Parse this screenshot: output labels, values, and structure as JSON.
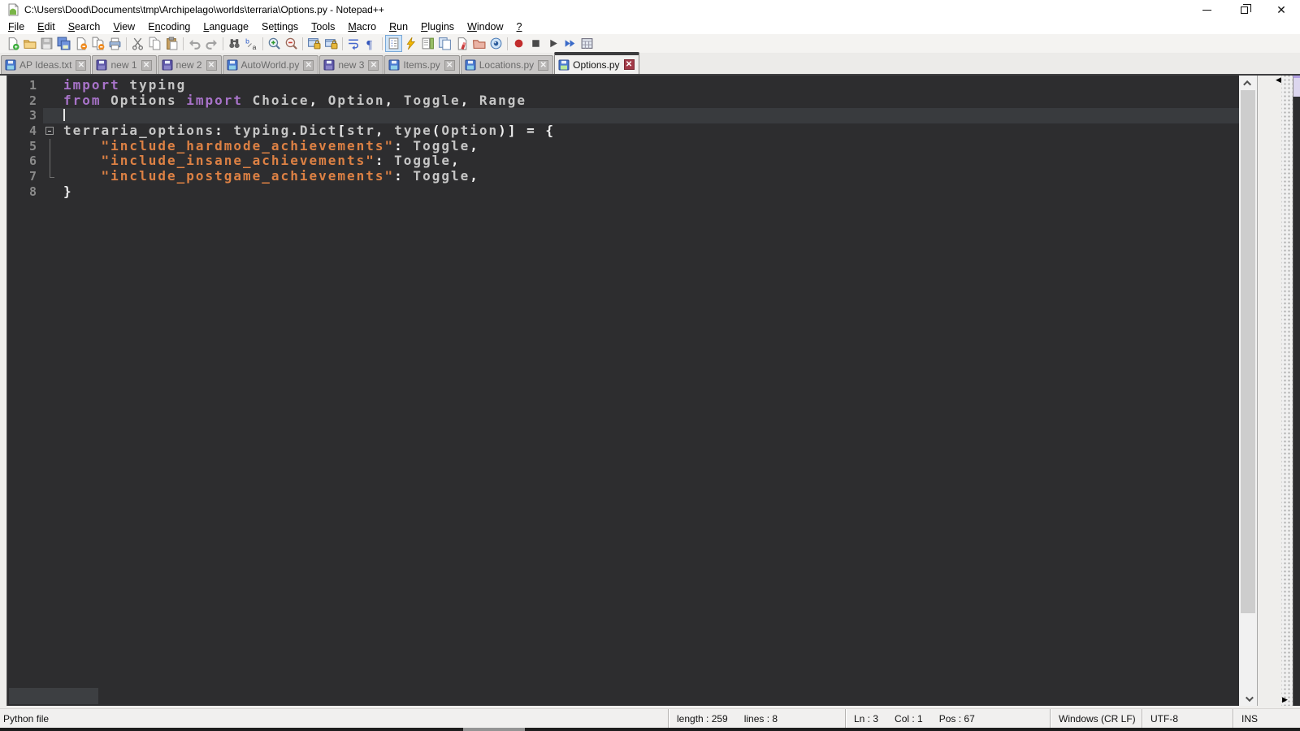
{
  "window": {
    "title": "C:\\Users\\Dood\\Documents\\tmp\\Archipelago\\worlds\\terraria\\Options.py - Notepad++",
    "controls": [
      {
        "name": "minimize-button",
        "icon": "minimize-icon"
      },
      {
        "name": "restore-button",
        "icon": "restore-icon"
      },
      {
        "name": "close-button",
        "icon": "close-icon"
      }
    ]
  },
  "menu": {
    "items": [
      {
        "label": "File",
        "underline": 0
      },
      {
        "label": "Edit",
        "underline": 0
      },
      {
        "label": "Search",
        "underline": 0
      },
      {
        "label": "View",
        "underline": 0
      },
      {
        "label": "Encoding",
        "underline": 1
      },
      {
        "label": "Language",
        "underline": 0
      },
      {
        "label": "Settings",
        "underline": 2
      },
      {
        "label": "Tools",
        "underline": 0
      },
      {
        "label": "Macro",
        "underline": 0
      },
      {
        "label": "Run",
        "underline": 0
      },
      {
        "label": "Plugins",
        "underline": 0
      },
      {
        "label": "Window",
        "underline": 0
      },
      {
        "label": "?",
        "underline": 0
      }
    ]
  },
  "toolbar": {
    "buttons": [
      {
        "name": "new-file-icon",
        "icon": "new"
      },
      {
        "name": "open-file-icon",
        "icon": "open"
      },
      {
        "name": "save-icon",
        "icon": "save"
      },
      {
        "name": "save-all-icon",
        "icon": "saveall"
      },
      {
        "name": "close-file-icon",
        "icon": "closedoc"
      },
      {
        "name": "close-all-icon",
        "icon": "closeall"
      },
      {
        "name": "print-icon",
        "icon": "print"
      },
      {
        "name": "separator"
      },
      {
        "name": "cut-icon",
        "icon": "cut"
      },
      {
        "name": "copy-icon",
        "icon": "copy"
      },
      {
        "name": "paste-icon",
        "icon": "paste"
      },
      {
        "name": "separator"
      },
      {
        "name": "undo-icon",
        "icon": "undo"
      },
      {
        "name": "redo-icon",
        "icon": "redo"
      },
      {
        "name": "separator"
      },
      {
        "name": "find-icon",
        "icon": "find"
      },
      {
        "name": "replace-icon",
        "icon": "replace"
      },
      {
        "name": "separator"
      },
      {
        "name": "zoom-in-icon",
        "icon": "zoomin"
      },
      {
        "name": "zoom-out-icon",
        "icon": "zoomout"
      },
      {
        "name": "separator"
      },
      {
        "name": "sync-vertical-scroll-icon",
        "icon": "syncv"
      },
      {
        "name": "sync-horizontal-scroll-icon",
        "icon": "synch"
      },
      {
        "name": "separator"
      },
      {
        "name": "word-wrap-icon",
        "icon": "wrap"
      },
      {
        "name": "show-all-characters-icon",
        "icon": "pilcrow"
      },
      {
        "name": "separator"
      },
      {
        "name": "indent-guide-icon",
        "icon": "indent",
        "active": true
      },
      {
        "name": "function-list-icon",
        "icon": "bolt"
      },
      {
        "name": "document-map-icon",
        "icon": "docmap"
      },
      {
        "name": "document-switcher-icon",
        "icon": "docswitch"
      },
      {
        "name": "file-monitoring-icon",
        "icon": "monitor"
      },
      {
        "name": "open-folder-icon",
        "icon": "folder2"
      },
      {
        "name": "view-eye-icon",
        "icon": "eye"
      },
      {
        "name": "separator"
      },
      {
        "name": "macro-record-icon",
        "icon": "record"
      },
      {
        "name": "macro-stop-icon",
        "icon": "stop"
      },
      {
        "name": "macro-play-icon",
        "icon": "play"
      },
      {
        "name": "macro-run-multiple-icon",
        "icon": "playmulti"
      },
      {
        "name": "macro-save-icon",
        "icon": "macrosave"
      }
    ]
  },
  "tabs": {
    "items": [
      {
        "label": "AP Ideas.txt",
        "active": false,
        "icon": "floppy-blue"
      },
      {
        "label": "new 1",
        "active": false,
        "icon": "floppy-purple"
      },
      {
        "label": "new 2",
        "active": false,
        "icon": "floppy-purple"
      },
      {
        "label": "AutoWorld.py",
        "active": false,
        "icon": "floppy-blue"
      },
      {
        "label": "new 3",
        "active": false,
        "icon": "floppy-purple"
      },
      {
        "label": "Items.py",
        "active": false,
        "icon": "floppy-blue"
      },
      {
        "label": "Locations.py",
        "active": false,
        "icon": "floppy-blue"
      },
      {
        "label": "Options.py",
        "active": true,
        "icon": "floppy-blue-green"
      }
    ],
    "close_icon": "x"
  },
  "editor": {
    "caret": {
      "line": 3,
      "col": 1
    },
    "lines": [
      {
        "num": 1,
        "fold": "",
        "tokens": [
          [
            "k",
            "import"
          ],
          [
            "d",
            " typing"
          ]
        ]
      },
      {
        "num": 2,
        "fold": "",
        "tokens": [
          [
            "k",
            "from"
          ],
          [
            "d",
            " Options "
          ],
          [
            "k",
            "import"
          ],
          [
            "d",
            " Choice"
          ],
          [
            "o",
            ","
          ],
          [
            "d",
            " Option"
          ],
          [
            "o",
            ","
          ],
          [
            "d",
            " Toggle"
          ],
          [
            "o",
            ","
          ],
          [
            "d",
            " Range"
          ]
        ]
      },
      {
        "num": 3,
        "fold": "",
        "tokens": []
      },
      {
        "num": 4,
        "fold": "minus",
        "tokens": [
          [
            "d",
            "terraria_options"
          ],
          [
            "o",
            ":"
          ],
          [
            "d",
            " typing"
          ],
          [
            "o",
            "."
          ],
          [
            "d",
            "Dict"
          ],
          [
            "o",
            "["
          ],
          [
            "d",
            "str"
          ],
          [
            "o",
            ","
          ],
          [
            "d",
            " type"
          ],
          [
            "o",
            "("
          ],
          [
            "d",
            "Option"
          ],
          [
            "o",
            ")"
          ],
          [
            "o",
            "]"
          ],
          [
            "d",
            " "
          ],
          [
            "o",
            "="
          ],
          [
            "d",
            " "
          ],
          [
            "o",
            "{"
          ]
        ]
      },
      {
        "num": 5,
        "fold": "line",
        "tokens": [
          [
            "d",
            "    "
          ],
          [
            "s",
            "\"include_hardmode_achievements\""
          ],
          [
            "o",
            ":"
          ],
          [
            "d",
            " Toggle"
          ],
          [
            "o",
            ","
          ]
        ]
      },
      {
        "num": 6,
        "fold": "line",
        "tokens": [
          [
            "d",
            "    "
          ],
          [
            "s",
            "\"include_insane_achievements\""
          ],
          [
            "o",
            ":"
          ],
          [
            "d",
            " Toggle"
          ],
          [
            "o",
            ","
          ]
        ]
      },
      {
        "num": 7,
        "fold": "corner",
        "tokens": [
          [
            "d",
            "    "
          ],
          [
            "s",
            "\"include_postgame_achievements\""
          ],
          [
            "o",
            ":"
          ],
          [
            "d",
            " Toggle"
          ],
          [
            "o",
            ","
          ]
        ]
      },
      {
        "num": 8,
        "fold": "",
        "tokens": [
          [
            "o",
            "}"
          ]
        ]
      }
    ]
  },
  "right_edge": {
    "tab_scroll_left_arrow": "◀",
    "tab_scroll_right_arrow": "▶"
  },
  "status_bar": {
    "doc_type": "Python file",
    "length_label": "length : 259",
    "lines_label": "lines : 8",
    "ln_label": "Ln : 3",
    "col_label": "Col : 1",
    "pos_label": "Pos : 67",
    "eol": "Windows (CR LF)",
    "encoding": "UTF-8",
    "insert_mode": "INS"
  },
  "colors": {
    "editor_bg": "#2d2d2f",
    "current_line_bg": "#393b3e",
    "line_number": "#8a8a8a",
    "keyword": "#a873c9",
    "default_text": "#c6c6c6",
    "operator": "#f0f0f0",
    "string": "#dd8144",
    "active_tab_stripe": "#3c3c3e",
    "close_button_active": "#a23a48"
  }
}
